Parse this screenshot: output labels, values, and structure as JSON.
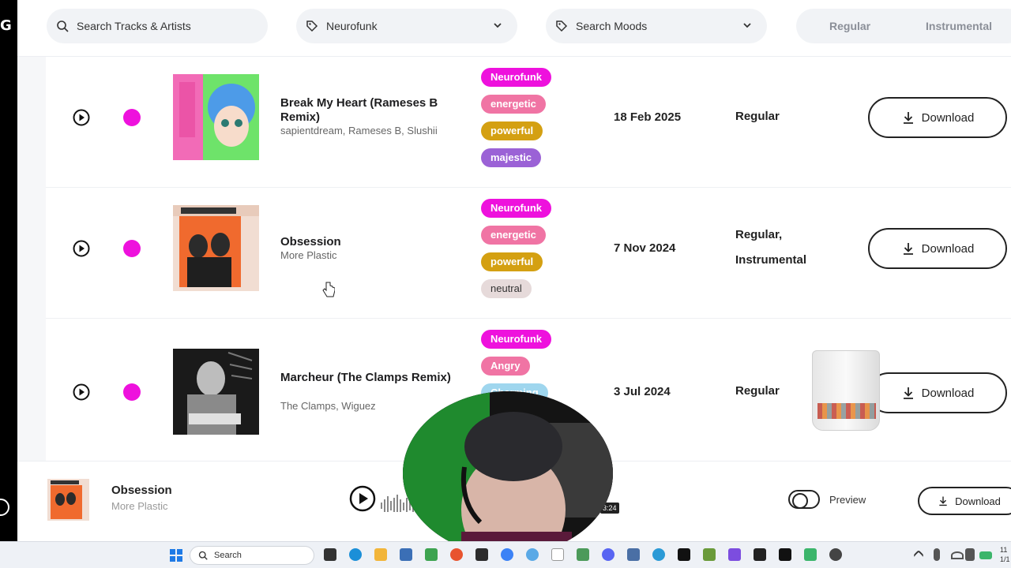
{
  "left_strip": {
    "logo": "G"
  },
  "topbar": {
    "search_placeholder": "Search Tracks & Artists",
    "genre_selected": "Neurofunk",
    "moods_placeholder": "Search Moods",
    "version_options": [
      "Regular",
      "Instrumental"
    ]
  },
  "tracks": [
    {
      "title": "Break My Heart (Rameses B Remix)",
      "artists": "sapientdream, Rameses B, Slushii",
      "tags": [
        {
          "label": "Neurofunk",
          "color": "#ee11dd"
        },
        {
          "label": "energetic",
          "color": "#f074a4"
        },
        {
          "label": "powerful",
          "color": "#d4a012"
        },
        {
          "label": "majestic",
          "color": "#9b62d6"
        }
      ],
      "date": "18 Feb 2025",
      "versions": [
        "Regular"
      ],
      "download_label": "Download"
    },
    {
      "title": "Obsession",
      "artists": "More Plastic",
      "tags": [
        {
          "label": "Neurofunk",
          "color": "#ee11dd"
        },
        {
          "label": "energetic",
          "color": "#f074a4"
        },
        {
          "label": "powerful",
          "color": "#d4a012"
        },
        {
          "label": "neutral",
          "color": "#e6dada"
        }
      ],
      "date": "7 Nov 2024",
      "versions": [
        "Regular,",
        "Instrumental"
      ],
      "download_label": "Download"
    },
    {
      "title": "Marcheur (The Clamps Remix)",
      "artists": "The Clamps, Wiguez",
      "tags": [
        {
          "label": "Neurofunk",
          "color": "#ee11dd"
        },
        {
          "label": "Angry",
          "color": "#f074a4"
        },
        {
          "label": "Charming",
          "color": "#9fd6ee"
        }
      ],
      "date": "3 Jul 2024",
      "versions": [
        "Regular"
      ],
      "download_label": "Download"
    }
  ],
  "player": {
    "title": "Obsession",
    "artist": "More Plastic",
    "duration": "3:24",
    "preview_label": "Preview",
    "download_label": "Download"
  },
  "taskbar": {
    "search_placeholder": "Search",
    "clock_line1": "11",
    "clock_line2": "1/1"
  },
  "colors": {
    "accent_dot": "#ee11dd",
    "background": "#f6f7f9"
  }
}
